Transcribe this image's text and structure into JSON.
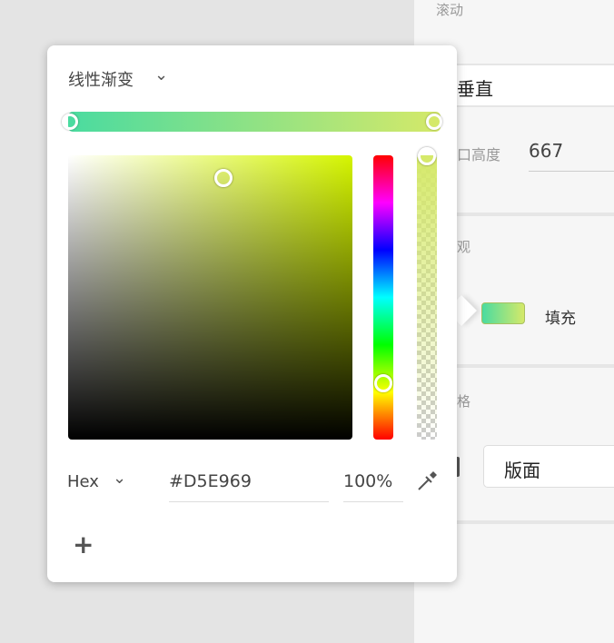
{
  "panel": {
    "scroll_label": "滚动",
    "scroll_value": "垂直",
    "height_label": "口高度",
    "height_value": "667",
    "appearance_label": "观",
    "fill_label": "填充",
    "grid_label": "格",
    "layout_value": "版面"
  },
  "picker": {
    "gradient_type": "线性渐变",
    "format": "Hex",
    "hex_value": "#D5E969",
    "opacity": "100%",
    "add": "+",
    "gradient_start": "#4adba0",
    "gradient_end": "#d5e969"
  }
}
